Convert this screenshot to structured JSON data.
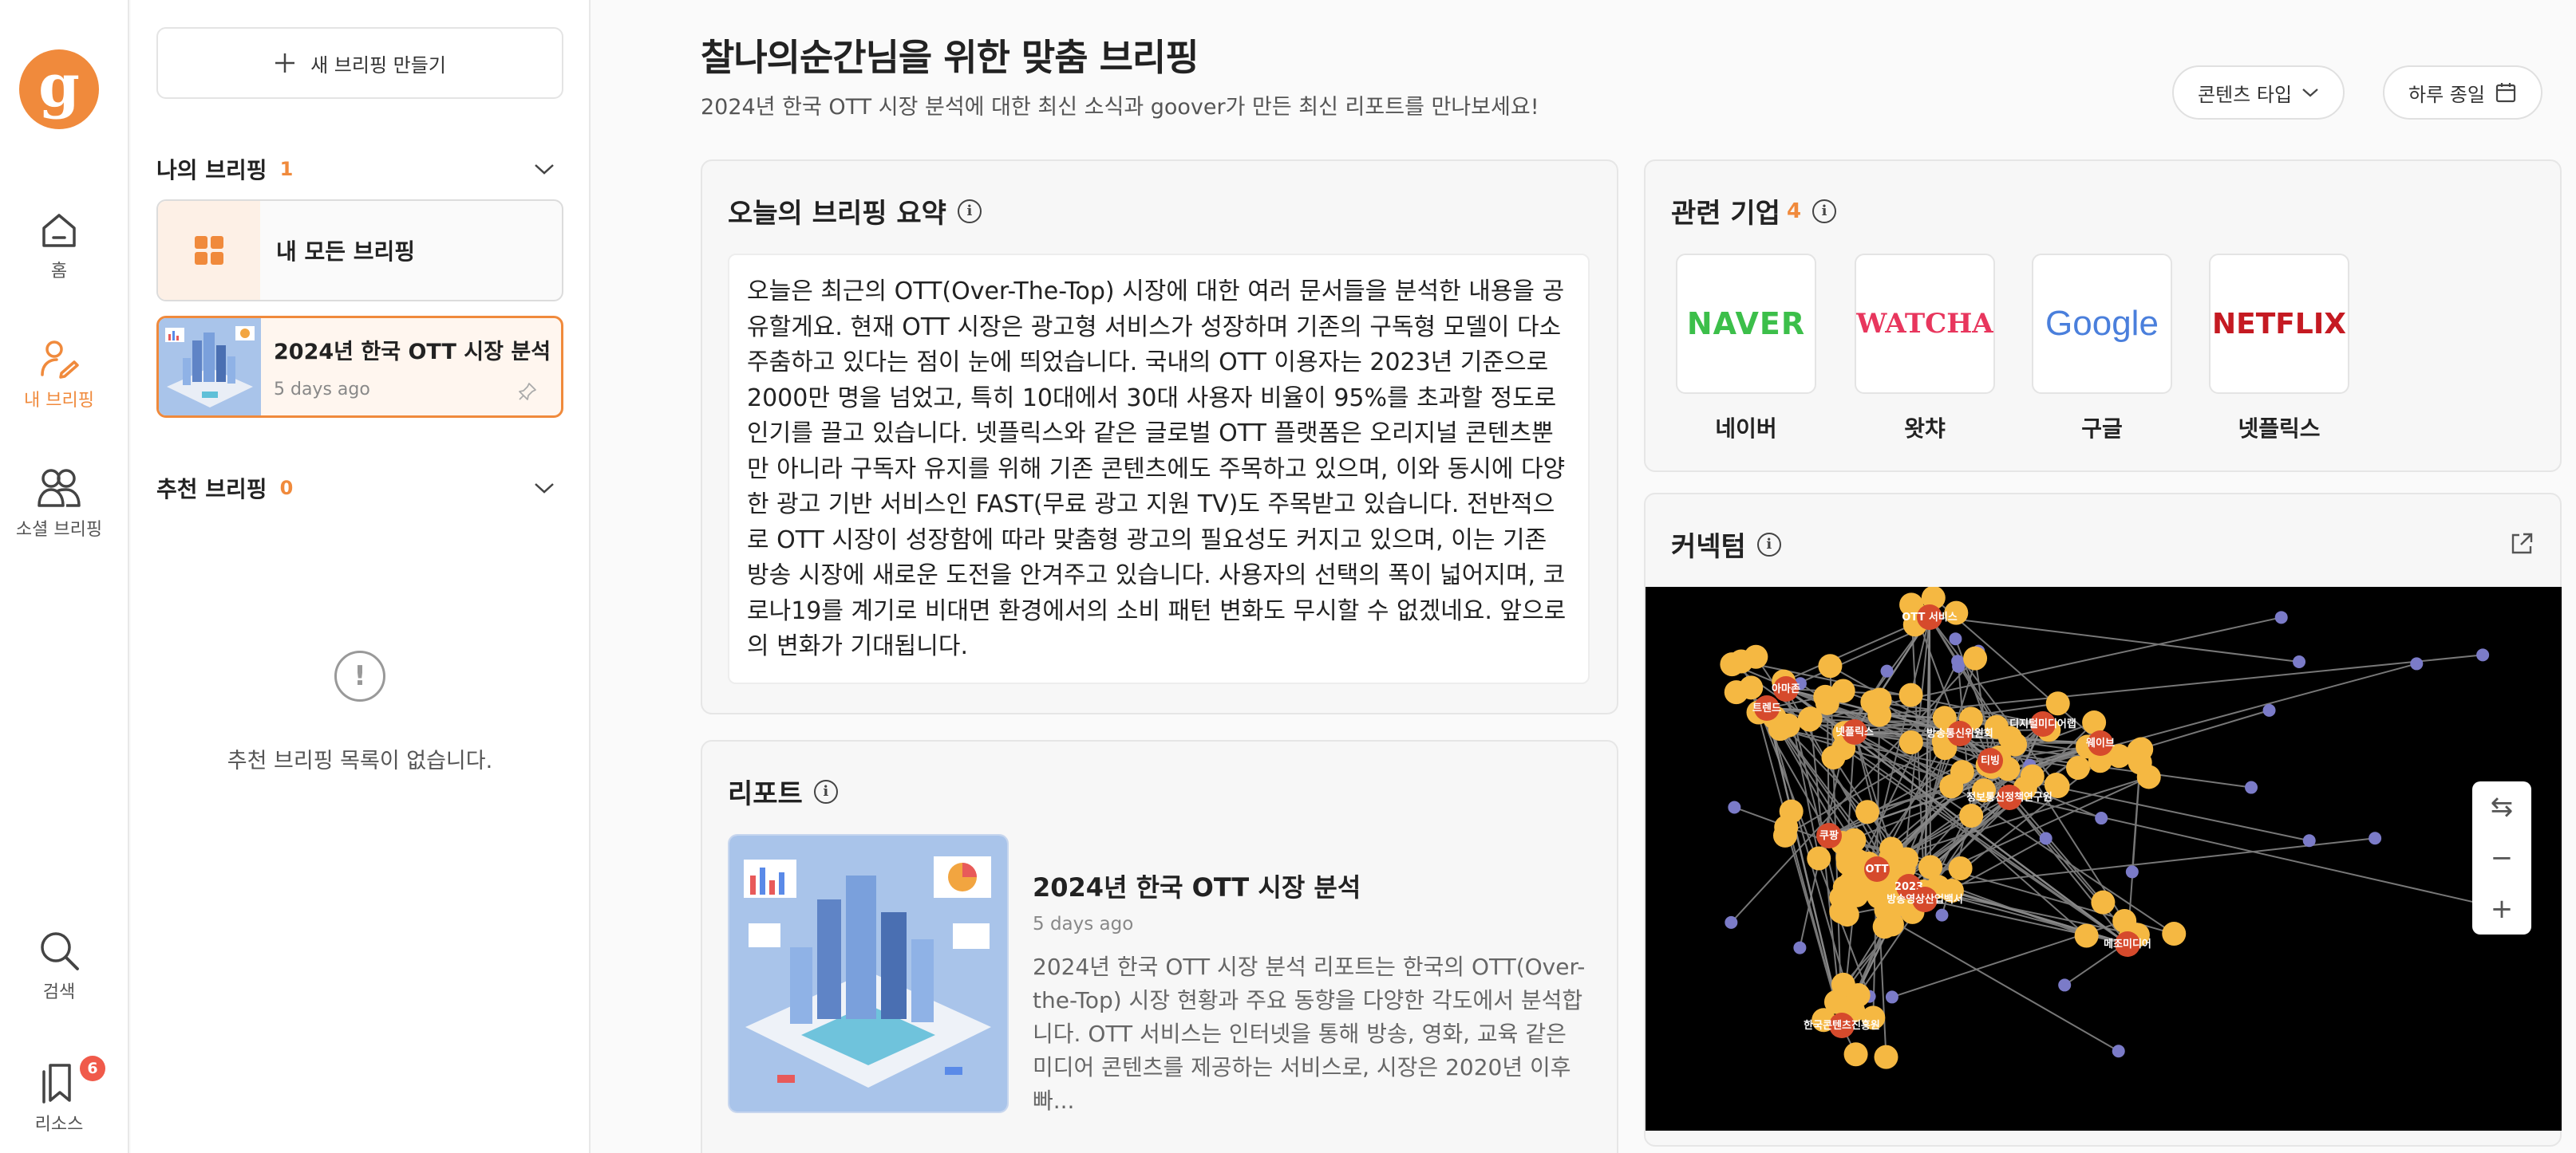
{
  "rail": {
    "logo": "g",
    "items": [
      {
        "label": "홈",
        "icon": "home-icon"
      },
      {
        "label": "내 브리핑",
        "icon": "my-briefing-icon"
      },
      {
        "label": "소셜 브리핑",
        "icon": "social-icon"
      },
      {
        "label": "검색",
        "icon": "search-icon"
      },
      {
        "label": "리소스",
        "icon": "bookmark-icon",
        "badge": "6"
      }
    ]
  },
  "sidebar": {
    "new_button": "새 브리핑 만들기",
    "my_section": {
      "title": "나의 브리핑",
      "count": "1"
    },
    "all_card": {
      "title": "내 모든 브리핑"
    },
    "brief_card": {
      "title": "2024년 한국 OTT 시장 분석",
      "time": "5 days ago"
    },
    "rec_section": {
      "title": "추천 브리핑",
      "count": "0"
    },
    "empty_message": "추천 브리핑 목록이 없습니다."
  },
  "header": {
    "title": "찰나의순간님을 위한 맞춤 브리핑",
    "subtitle": "2024년 한국 OTT 시장 분석에 대한 최신 소식과 goover가 만든 최신 리포트를 만나보세요!",
    "content_type": "콘텐츠 타입",
    "schedule": "하루 종일"
  },
  "summary": {
    "title": "오늘의 브리핑 요약",
    "text": "오늘은 최근의 OTT(Over-The-Top) 시장에 대한 여러 문서들을 분석한 내용을 공유할게요. 현재 OTT 시장은 광고형 서비스가 성장하며 기존의 구독형 모델이 다소 주춤하고 있다는 점이 눈에 띄었습니다. 국내의 OTT 이용자는 2023년 기준으로 2000만 명을 넘었고, 특히 10대에서 30대 사용자 비율이 95%를 초과할 정도로 인기를 끌고 있습니다. 넷플릭스와 같은 글로벌 OTT 플랫폼은 오리지널 콘텐츠뿐만 아니라 구독자 유지를 위해 기존 콘텐츠에도 주목하고 있으며, 이와 동시에 다양한 광고 기반 서비스인 FAST(무료 광고 지원 TV)도 주목받고 있습니다. 전반적으로 OTT 시장이 성장함에 따라 맞춤형 광고의 필요성도 커지고 있으며, 이는 기존 방송 시장에 새로운 도전을 안겨주고 있습니다. 사용자의 선택의 폭이 넓어지며, 코로나19를 계기로 비대면 환경에서의 소비 패턴 변화도 무시할 수 없겠네요. 앞으로의 변화가 기대됩니다."
  },
  "report": {
    "section_title": "리포트",
    "title": "2024년 한국 OTT 시장 분석",
    "time": "5 days ago",
    "description": "2024년 한국 OTT 시장 분석 리포트는 한국의 OTT(Over-the-Top) 시장 현황과 주요 동향을 다양한 각도에서 분석합니다. OTT 서비스는 인터넷을 통해 방송, 영화, 교육 같은 미디어 콘텐츠를 제공하는 서비스로, 시장은 2020년 이후 빠..."
  },
  "companies": {
    "title": "관련 기업",
    "count": "4",
    "items": [
      {
        "logo": "NAVER",
        "name": "네이버",
        "color": "#3cbf4a"
      },
      {
        "logo": "WATCHA",
        "name": "왓챠",
        "color": "#e8365d"
      },
      {
        "logo": "Google",
        "name": "구글",
        "color": "#4a7fdc"
      },
      {
        "logo": "NETFLIX",
        "name": "넷플릭스",
        "color": "#c51a22"
      }
    ]
  },
  "network": {
    "title": "커넥텀",
    "labels": [
      "OTT 서비스",
      "아마존",
      "트렌드",
      "넷플릭스",
      "방송통신위원회",
      "디지털미디어랩",
      "웨이브",
      "티빙",
      "정보통신정책연구원",
      "쿠팡",
      "OTT",
      "2023",
      "방송영상산업백서",
      "메조미디어",
      "한국콘텐츠진흥원"
    ],
    "zoom": {
      "fit": "⇆",
      "minus": "−",
      "plus": "+"
    }
  },
  "colors": {
    "accent": "#f08a3c",
    "node_major": "#d64a2c",
    "node_minor": "#f5b842",
    "node_small": "#7b7bc8"
  }
}
